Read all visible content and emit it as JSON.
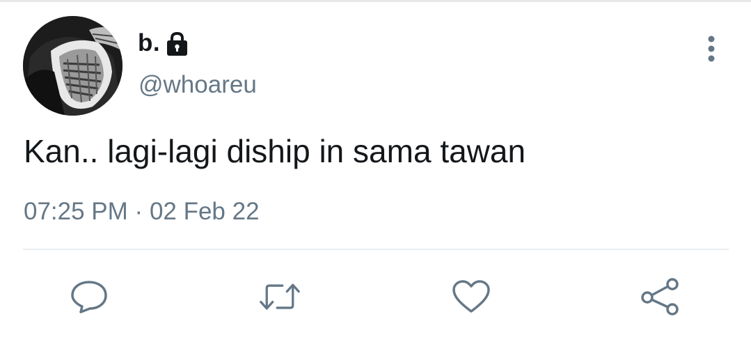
{
  "user": {
    "display_name": "b.",
    "handle": "@whoareu",
    "protected_icon": "lock-icon",
    "avatar_icon": "profile-avatar"
  },
  "tweet": {
    "text": "Kan.. lagi-lagi diship in sama tawan",
    "time": "07:25 PM",
    "separator": "·",
    "date": "02 Feb 22"
  },
  "menu": {
    "icon": "more-vertical-icon"
  },
  "actions": [
    {
      "icon": "reply-icon"
    },
    {
      "icon": "retweet-icon"
    },
    {
      "icon": "like-icon"
    },
    {
      "icon": "share-icon"
    }
  ],
  "colors": {
    "text_primary": "#14171a",
    "text_secondary": "#657786",
    "icon": "#657786",
    "divider": "#e6ecf0",
    "background": "#ffffff"
  }
}
